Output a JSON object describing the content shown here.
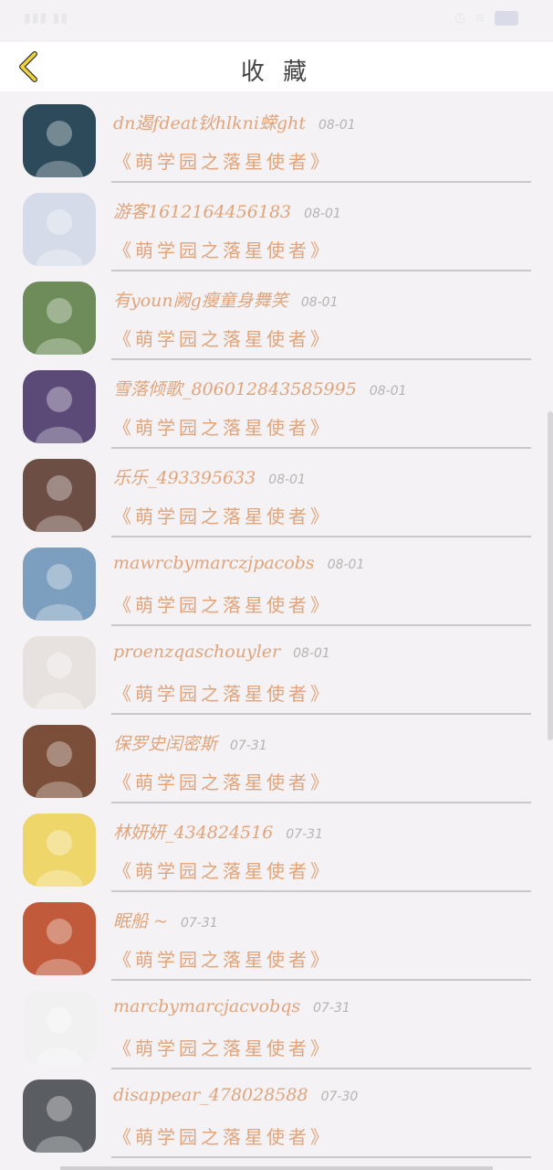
{
  "header": {
    "title": "收 藏"
  },
  "list": [
    {
      "name": "dn遏fdeat钬hlkni蝾ght",
      "date": "08-01",
      "book": "《萌学园之落星使者》",
      "avatar_color": "#2c4a5a"
    },
    {
      "name": "游客1612164456183",
      "date": "08-01",
      "book": "《萌学园之落星使者》",
      "avatar_color": "#d5dbe9"
    },
    {
      "name": "有youn阙g瘦童身舞笑",
      "date": "08-01",
      "book": "《萌学园之落星使者》",
      "avatar_color": "#6e8b5a"
    },
    {
      "name": "雪落倾歌_806012843585995",
      "date": "08-01",
      "book": "《萌学园之落星使者》",
      "avatar_color": "#5b4a78"
    },
    {
      "name": "乐乐_493395633",
      "date": "08-01",
      "book": "《萌学园之落星使者》",
      "avatar_color": "#6c4e44"
    },
    {
      "name": "mawrcbymarczjpacobs",
      "date": "08-01",
      "book": "《萌学园之落星使者》",
      "avatar_color": "#7c9fbf"
    },
    {
      "name": "proenzqaschouyler",
      "date": "08-01",
      "book": "《萌学园之落星使者》",
      "avatar_color": "#e7e2e0"
    },
    {
      "name": "保罗史闰密斯",
      "date": "07-31",
      "book": "《萌学园之落星使者》",
      "avatar_color": "#7a4e38"
    },
    {
      "name": "林妍妍_434824516",
      "date": "07-31",
      "book": "《萌学园之落星使者》",
      "avatar_color": "#efd66a"
    },
    {
      "name": "眠船 ~",
      "date": "07-31",
      "book": "《萌学园之落星使者》",
      "avatar_color": "#c05a3a"
    },
    {
      "name": "marcbymarcjacvobqs",
      "date": "07-31",
      "book": "《萌学园之落星使者》",
      "avatar_color": "#f1f1f1"
    },
    {
      "name": "disappear_478028588",
      "date": "07-30",
      "book": "《萌学园之落星使者》",
      "avatar_color": "#5a5d62"
    }
  ]
}
